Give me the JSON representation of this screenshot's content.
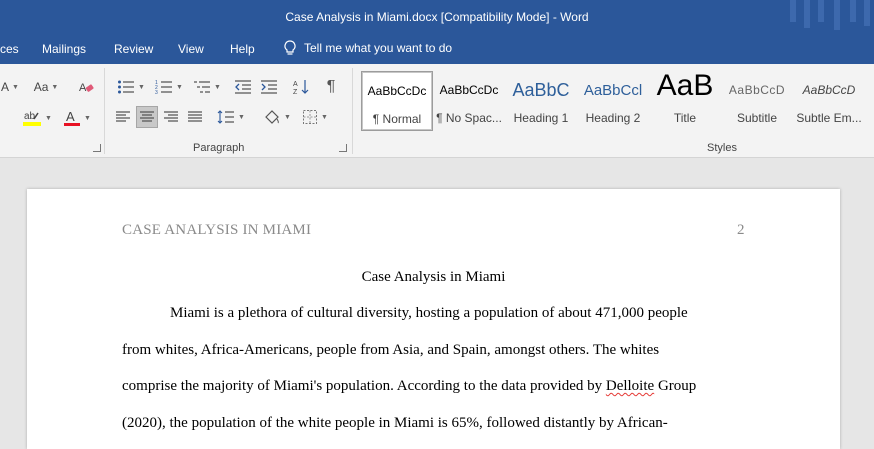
{
  "window": {
    "title": "Case Analysis in Miami.docx [Compatibility Mode]  -  Word"
  },
  "menu": {
    "tabs": [
      "ces",
      "Mailings",
      "Review",
      "View",
      "Help"
    ],
    "tell_me": "Tell me what you want to do"
  },
  "ribbon": {
    "font_size_label": "A",
    "change_case_label": "Aa",
    "paragraph_label": "Paragraph",
    "styles_label": "Styles",
    "styles": [
      {
        "preview": "AaBbCcDc",
        "name": "¶ Normal"
      },
      {
        "preview": "AaBbCcDc",
        "name": "¶ No Spac..."
      },
      {
        "preview": "AaBbC",
        "name": "Heading 1"
      },
      {
        "preview": "AaBbCcl",
        "name": "Heading 2"
      },
      {
        "preview": "AaB",
        "name": "Title"
      },
      {
        "preview": "AaBbCcD",
        "name": "Subtitle"
      },
      {
        "preview": "AaBbCcD",
        "name": "Subtle Em..."
      }
    ]
  },
  "document": {
    "header_title": "CASE ANALYSIS IN MIAMI",
    "page_number": "2",
    "title": "Case Analysis in Miami",
    "lines": [
      "Miami is a plethora of cultural diversity, hosting a population of about 471,000 people",
      "from whites, Africa-Americans, people from Asia, and Spain, amongst others. The whites",
      "comprise the majority of Miami's population. According to the data provided by ",
      "(2020), the population of the white people in Miami is 65%, followed distantly by African-"
    ],
    "misspelled": "Delloite",
    "line3_tail": " Group"
  },
  "colors": {
    "accent": "#2b579a",
    "font_color_bar": "#e81123",
    "highlight_bar": "#ffff00",
    "squiggle": "#e53935"
  }
}
